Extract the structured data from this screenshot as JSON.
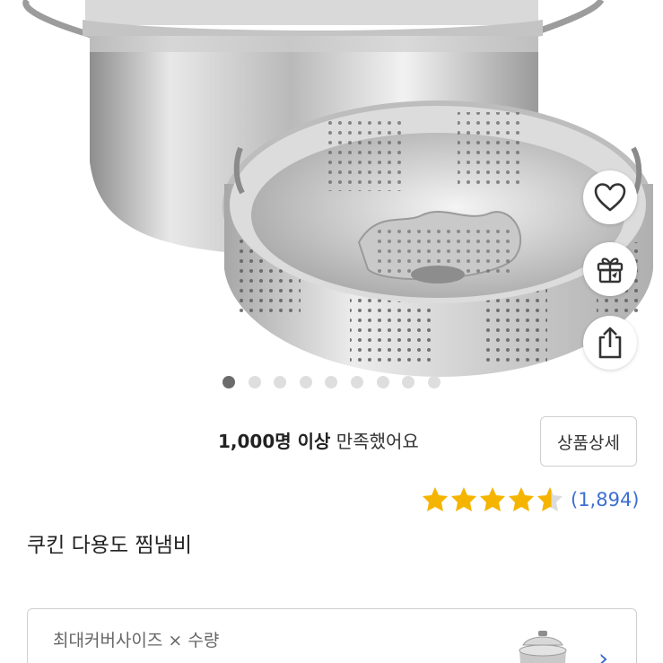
{
  "product_gallery": {
    "image_alt": "stainless steel steamer pot with steamer basket",
    "page_count": 9,
    "active_index": 0
  },
  "actions": {
    "wishlist_icon": "heart-icon",
    "gift_icon": "gift-icon",
    "share_icon": "share-icon"
  },
  "summary": {
    "satisfaction_bold": "1,000명 이상",
    "satisfaction_rest": "만족했어요",
    "detail_button": "상품상세"
  },
  "rating": {
    "stars": 4.5,
    "max_stars": 5,
    "review_count": "(1,894)"
  },
  "product": {
    "title": "쿠킨 다용도 찜냄비"
  },
  "option": {
    "label": "최대커버사이즈 × 수량"
  },
  "colors": {
    "star": "#f5b400",
    "link": "#3d6fd1",
    "dot_active": "#6b6b6b",
    "dot_inactive": "#dedede"
  }
}
